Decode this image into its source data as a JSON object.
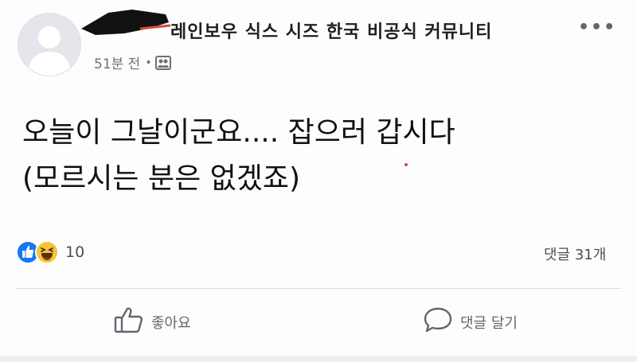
{
  "post": {
    "group_name": "레인보우 식스 시즈 한국 비공식 커뮤니티",
    "time_ago": "51분 전",
    "meta_separator": "•",
    "more_label": "•••",
    "text_line_1": "오늘이 그날이군요.... 잡으러 갑시다",
    "text_line_2": "(모르시는 분은 없겠죠)"
  },
  "reactions": {
    "types": [
      "like-icon",
      "haha-icon"
    ],
    "count": "10",
    "comments_count": "댓글 31개"
  },
  "actions": {
    "like_label": "좋아요",
    "comment_label": "댓글 달기"
  },
  "colors": {
    "like_blue": "#1877f2",
    "haha_yellow": "#f7c433",
    "text_secondary": "#606770",
    "divider": "#dadde1",
    "redaction_black": "#111111",
    "redaction_red": "#e0453a"
  }
}
